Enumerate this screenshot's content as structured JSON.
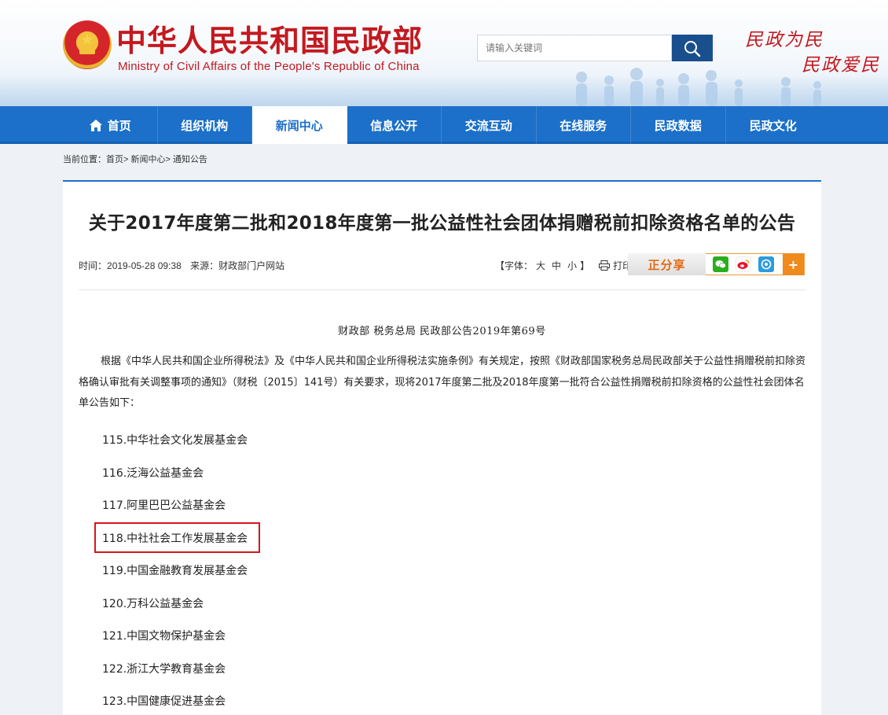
{
  "header": {
    "site_title": "中华人民共和国民政部",
    "site_subtitle": "Ministry of Civil Affairs of the People's Republic of China",
    "search_placeholder": "请输入关键词",
    "slogan_line1": "民政为民",
    "slogan_line2": "民政爱民"
  },
  "nav": {
    "items": [
      {
        "label": "首页",
        "icon": "home-icon"
      },
      {
        "label": "组织机构"
      },
      {
        "label": "新闻中心",
        "active": true
      },
      {
        "label": "信息公开"
      },
      {
        "label": "交流互动"
      },
      {
        "label": "在线服务"
      },
      {
        "label": "民政数据"
      },
      {
        "label": "民政文化"
      }
    ]
  },
  "breadcrumb": {
    "prefix": "当前位置：",
    "items": [
      "首页",
      "新闻中心",
      "通知公告"
    ],
    "separator": ">"
  },
  "article": {
    "title": "关于2017年度第二批和2018年度第一批公益性社会团体捐赠税前扣除资格名单的公告",
    "time_label": "时间：",
    "time": "2019-05-28 09:38",
    "source_label": "来源：",
    "source": "财政部门户网站",
    "font_label": "【字体：",
    "font_sizes": [
      "大",
      "中",
      "小"
    ],
    "font_close": "】",
    "print_label": "打印",
    "share_label": "正分享",
    "subhead": "财政部 税务总局 民政部公告2019年第69号",
    "paragraph": "根据《中华人民共和国企业所得税法》及《中华人民共和国企业所得税法实施条例》有关规定，按照《财政部国家税务总局民政部关于公益性捐赠税前扣除资格确认审批有关调整事项的通知》（财税〔2015〕141号）有关要求，现将2017年度第二批及2018年度第一批符合公益性捐赠税前扣除资格的公益性社会团体名单公告如下：",
    "list": [
      "115.中华社会文化发展基金会",
      "116.泛海公益基金会",
      "117.阿里巴巴公益基金会",
      "118.中社社会工作发展基金会",
      "119.中国金融教育发展基金会",
      "120.万科公益基金会",
      "121.中国文物保护基金会",
      "122.浙江大学教育基金会",
      "123.中国健康促进基金会"
    ],
    "highlighted_index": 3
  },
  "colors": {
    "brand_red": "#c3191f",
    "nav_blue": "#1c70c9",
    "search_button": "#1a4f8e",
    "highlight_border": "#d4161c",
    "share_orange": "#e46a12"
  }
}
